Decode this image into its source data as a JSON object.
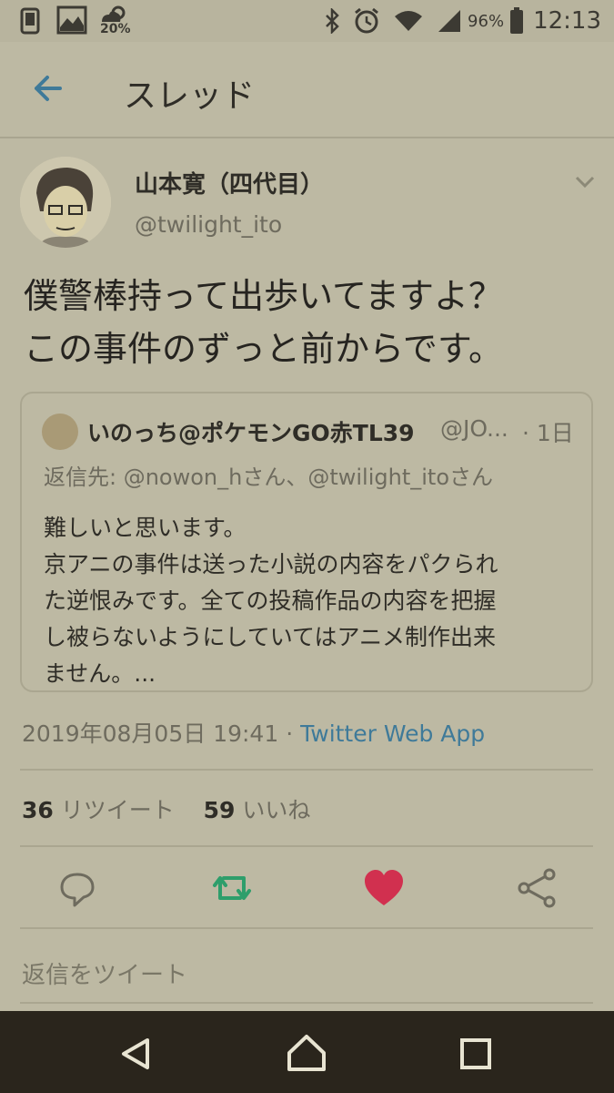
{
  "status_bar": {
    "left_icons": [
      "phone-icon",
      "image-icon",
      "weather-icon"
    ],
    "temperature": "20%",
    "right_icons": [
      "bluetooth-icon",
      "alarm-icon",
      "wifi-icon",
      "signal-icon",
      "battery-icon"
    ],
    "battery": "96%",
    "time": "12:13"
  },
  "appbar": {
    "title": "スレッド",
    "back_icon": "arrow-left-icon"
  },
  "tweet": {
    "display_name": "山本寛（四代目）",
    "handle": "@twilight_ito",
    "text_lines": [
      "僕警棒持って出歩いてますよ？",
      "この事件のずっと前からです。"
    ],
    "timestamp": "2019年08月05日 19:41",
    "separator": "·",
    "source": "Twitter Web App",
    "retweet_count": "36",
    "retweet_label": "リツイート",
    "like_count": "59",
    "like_label": "いいね"
  },
  "quoted": {
    "display_name": "いのっち@ポケモンGO赤TL39",
    "handle": "@JO...",
    "time": "· 1日",
    "reply_to": "返信先: @nowon_hさん、@twilight_itoさん",
    "body_lines": [
      "難しいと思います。",
      "京アニの事件は送った小説の内容をパクられ",
      "た逆恨みです。全ての投稿作品の内容を把握",
      "し被らないようにしていてはアニメ制作出来",
      "ません。..."
    ]
  },
  "reply_placeholder": "返信をツイート",
  "colors": {
    "accent": "#3f7a99",
    "retweet": "#2e9e6b",
    "like": "#d1304f",
    "background": "#bdb9a3"
  }
}
